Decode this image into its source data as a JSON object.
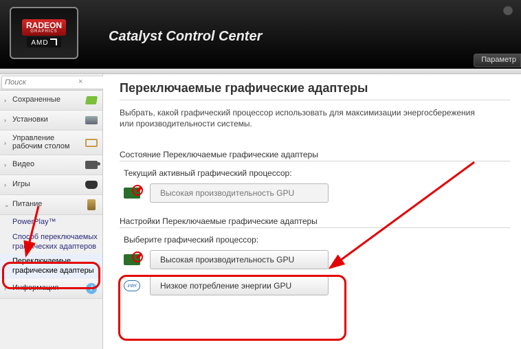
{
  "header": {
    "app_title": "Catalyst Control Center",
    "logo_top": "RADEON",
    "logo_sub": "GRAPHICS",
    "logo_brand": "AMD",
    "params_button": "Параметр"
  },
  "search": {
    "placeholder": "Поиск",
    "collapse_glyph": "«"
  },
  "sidebar": {
    "items": [
      {
        "label": "Сохраненные",
        "icon": "green"
      },
      {
        "label": "Установки",
        "icon": "card"
      },
      {
        "label": "Управление рабочим столом",
        "icon": "monitor"
      },
      {
        "label": "Видео",
        "icon": "cam"
      },
      {
        "label": "Игры",
        "icon": "pad"
      },
      {
        "label": "Питание",
        "icon": "bat"
      },
      {
        "label": "Информация",
        "icon": "info"
      }
    ],
    "power_children": [
      "PowerPlay™",
      "Способ переключаемых графических адаптеров",
      "Переключаемые графические адаптеры"
    ]
  },
  "page": {
    "title": "Переключаемые графические адаптеры",
    "description": "Выбрать, какой графический процессор использовать для максимизации энергосбережения или производительности системы."
  },
  "status_group": {
    "title": "Состояние Переключаемые графические адаптеры",
    "label": "Текущий активный графический процессор:",
    "value": "Высокая производительность GPU"
  },
  "settings_group": {
    "title": "Настройки Переключаемые графические адаптеры",
    "label": "Выберите графический процессор:",
    "high_perf": "Высокая производительность GPU",
    "low_power": "Низкое потребление энергии GPU"
  }
}
